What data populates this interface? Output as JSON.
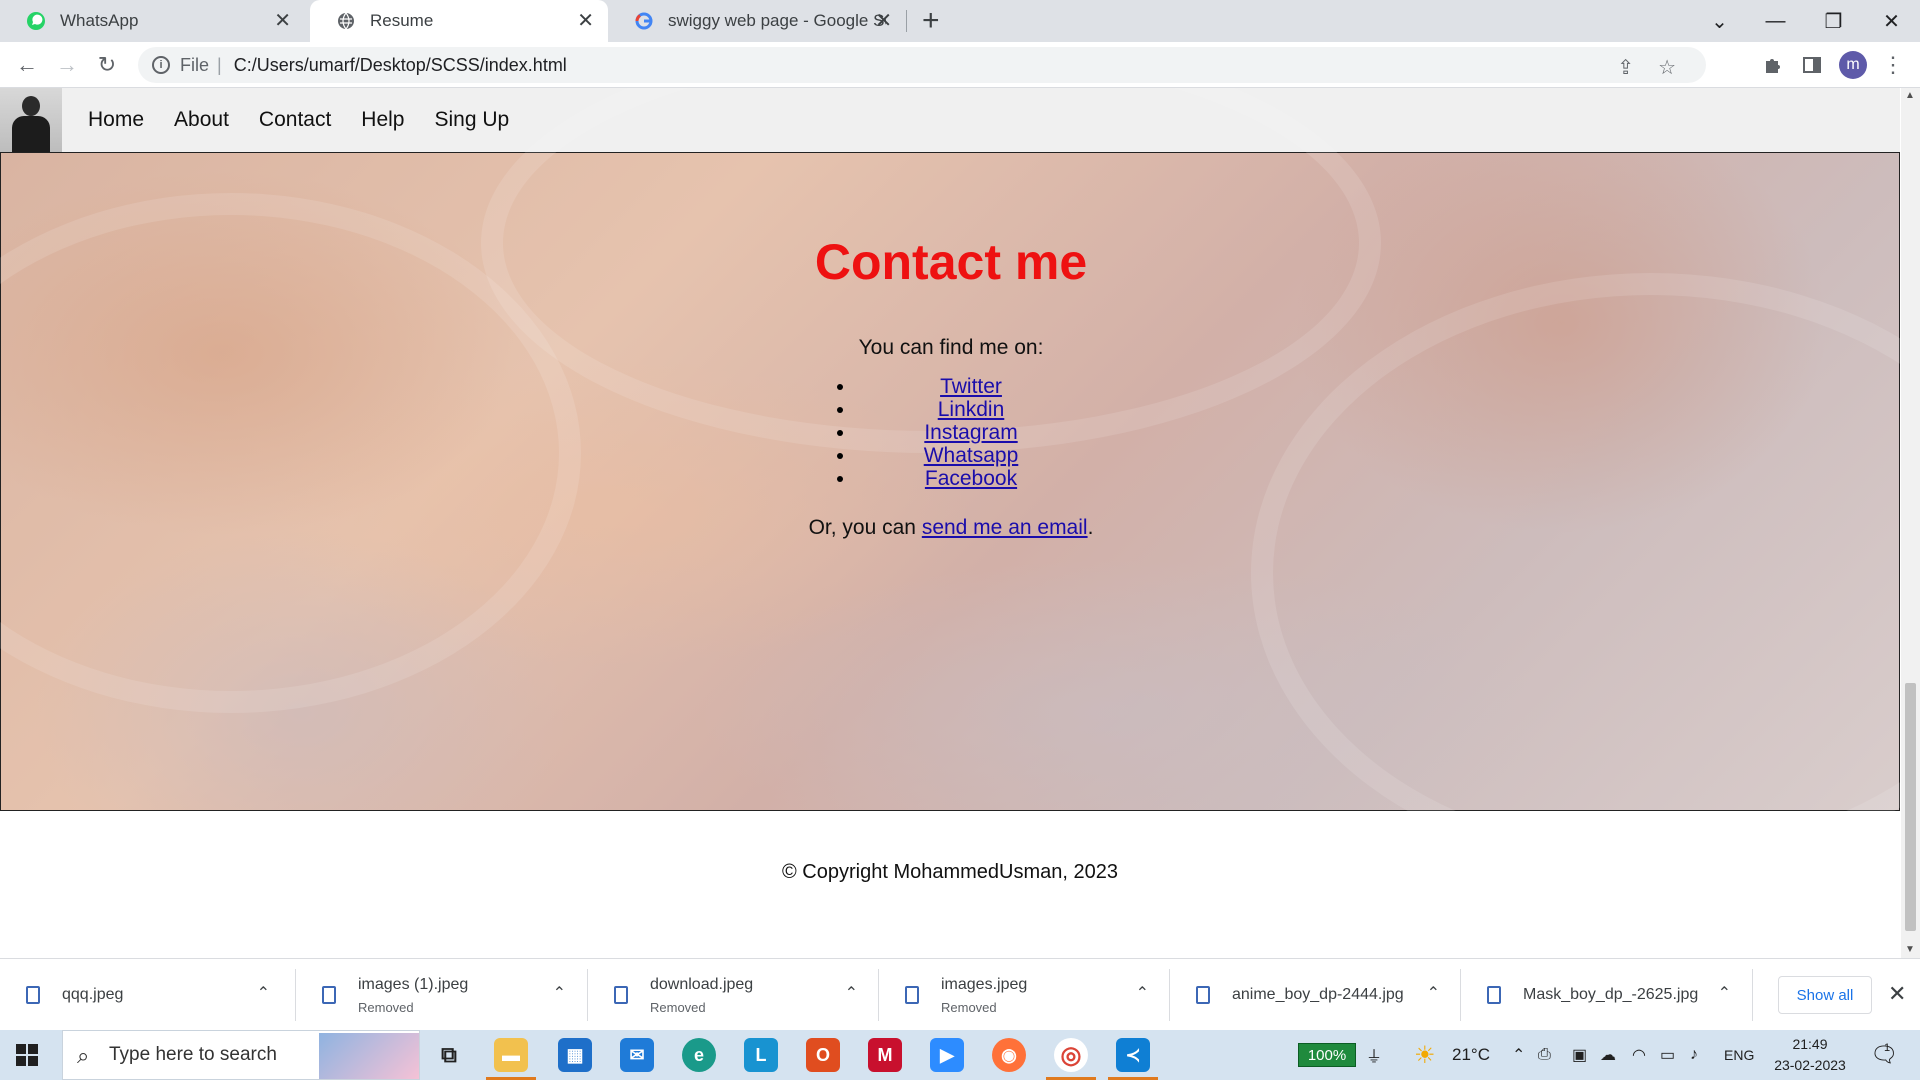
{
  "browser": {
    "tabs": [
      {
        "title": "WhatsApp",
        "icon": "whatsapp-icon"
      },
      {
        "title": "Resume",
        "icon": "globe-icon",
        "active": true
      },
      {
        "title": "swiggy web page - Google Searc",
        "icon": "google-icon"
      }
    ],
    "address": {
      "scheme": "File",
      "url": "C:/Users/umarf/Desktop/SCSS/index.html"
    },
    "profile_initial": "m"
  },
  "site": {
    "nav": [
      "Home",
      "About",
      "Contact",
      "Help",
      "Sing Up"
    ],
    "contact": {
      "heading": "Contact me",
      "intro": "You can find me on:",
      "links": [
        "Twitter",
        "Linkdin",
        "Instagram",
        "Whatsapp",
        "Facebook"
      ],
      "email_prefix": "Or, you can ",
      "email_link": "send me an email",
      "email_suffix": "."
    },
    "footer": "© Copyright MohammedUsman, 2023"
  },
  "downloads": {
    "items": [
      {
        "name": "qqq.jpeg",
        "status": ""
      },
      {
        "name": "images (1).jpeg",
        "status": "Removed"
      },
      {
        "name": "download.jpeg",
        "status": "Removed"
      },
      {
        "name": "images.jpeg",
        "status": "Removed"
      },
      {
        "name": "anime_boy_dp-2444.jpg",
        "status": ""
      },
      {
        "name": "Mask_boy_dp_-2625.jpg",
        "status": ""
      }
    ],
    "show_all": "Show all"
  },
  "taskbar": {
    "search_placeholder": "Type here to search",
    "battery": "100%",
    "temperature": "21°C",
    "language": "ENG",
    "time": "21:49",
    "date": "23-02-2023",
    "notification_count": "1"
  },
  "colors": {
    "heading": "#ee1111",
    "link": "#1a0dab",
    "accent": "#1a73e8"
  }
}
